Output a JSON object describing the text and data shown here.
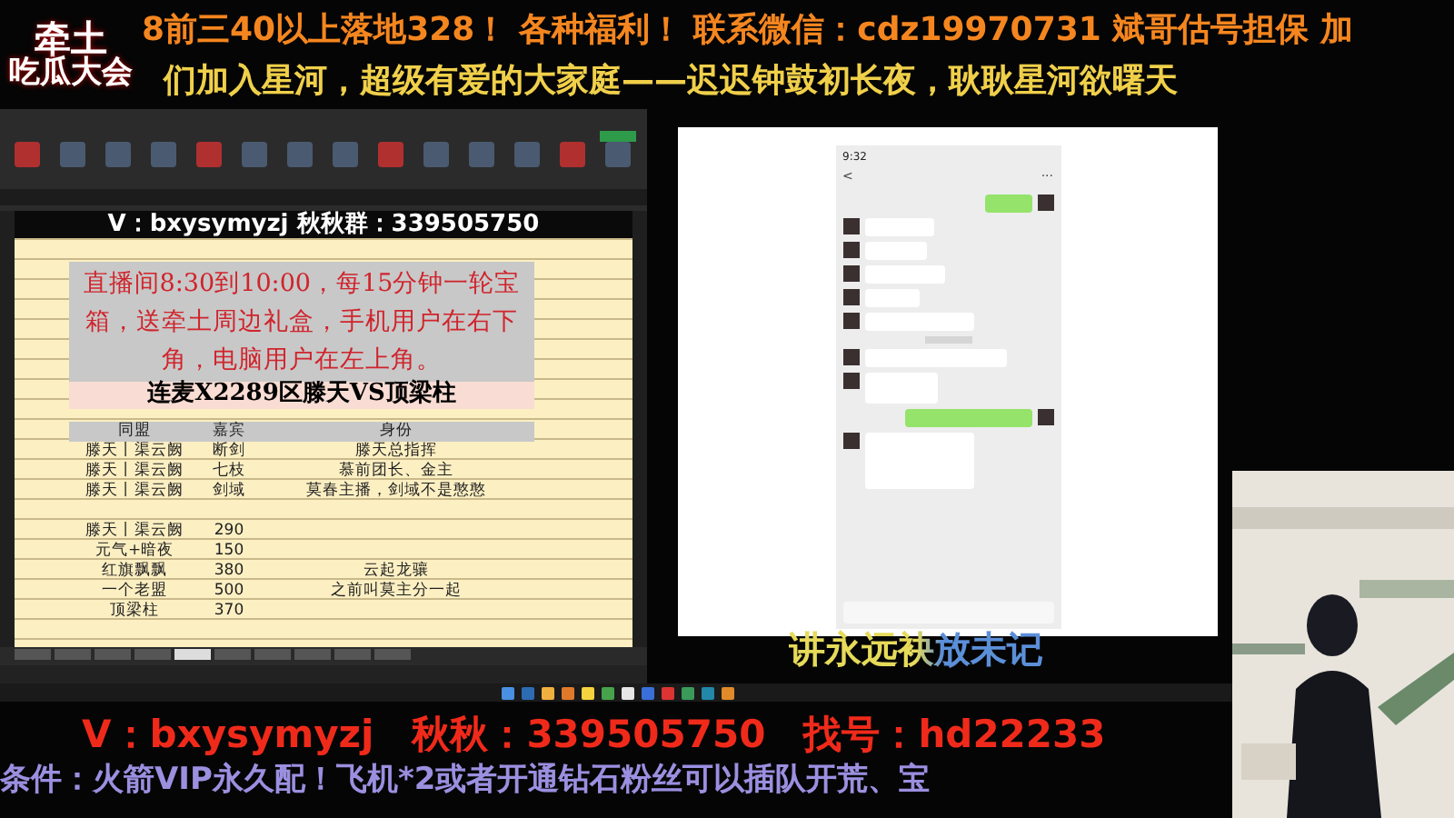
{
  "logo": {
    "lines": [
      "牵土",
      "吃瓜大会"
    ]
  },
  "banner": {
    "lines": [
      "8前三40以上落地328！ 各种福利！ 联系微信：cdz19970731 斌哥估号担保 加",
      "们加入星河，超级有爱的大家庭——迟迟钟鼓初长夜，耿耿星河欲曙天"
    ]
  },
  "spreadsheet": {
    "header": "V：bxysymyzj  秋秋群：339505750",
    "notice": "直播间8:30到10:00，每15分钟一轮宝箱，送牵土周边礼盒，手机用户在右下角，电脑用户在左上角。",
    "title": "连麦X2289区滕天VS顶梁柱",
    "columns": [
      "同盟",
      "嘉宾",
      "身份"
    ],
    "rows": [
      [
        "滕天丨渠云阙",
        "断剑",
        "滕天总指挥"
      ],
      [
        "滕天丨渠云阙",
        "七枝",
        "慕前团长、金主"
      ],
      [
        "滕天丨渠云阙",
        "剑域",
        "莫春主播，剑域不是憨憨"
      ],
      [
        "",
        "",
        ""
      ],
      [
        "滕天丨渠云阙",
        "290",
        ""
      ],
      [
        "元气+暗夜",
        "150",
        ""
      ],
      [
        "红旗飘飘",
        "380",
        "云起龙骧"
      ],
      [
        "一个老盟",
        "500",
        "之前叫莫主分一起"
      ],
      [
        "顶梁柱",
        "370",
        ""
      ]
    ],
    "sheet_tabs": [
      {
        "selected": false
      },
      {
        "selected": false
      },
      {
        "selected": false
      },
      {
        "selected": false
      },
      {
        "selected": true
      },
      {
        "selected": false
      },
      {
        "selected": false
      },
      {
        "selected": false
      },
      {
        "selected": false
      },
      {
        "selected": false
      }
    ]
  },
  "phone": {
    "time": "9:32",
    "back": "<",
    "more": "···",
    "messages": [
      {
        "kind": "sent"
      },
      {
        "kind": "received"
      },
      {
        "kind": "received"
      },
      {
        "kind": "received"
      },
      {
        "kind": "received"
      },
      {
        "kind": "received"
      },
      {
        "kind": "time"
      },
      {
        "kind": "received"
      },
      {
        "kind": "received"
      },
      {
        "kind": "sent"
      },
      {
        "kind": "received"
      }
    ]
  },
  "subtitle": "讲永远袂放未记",
  "contact": "V：bxysymyzj　秋秋：339505750　找号：hd22233",
  "conditions": "条件：火箭VIP永久配！飞机*2或者开通钻石粉丝可以插队开荒、宝"
}
